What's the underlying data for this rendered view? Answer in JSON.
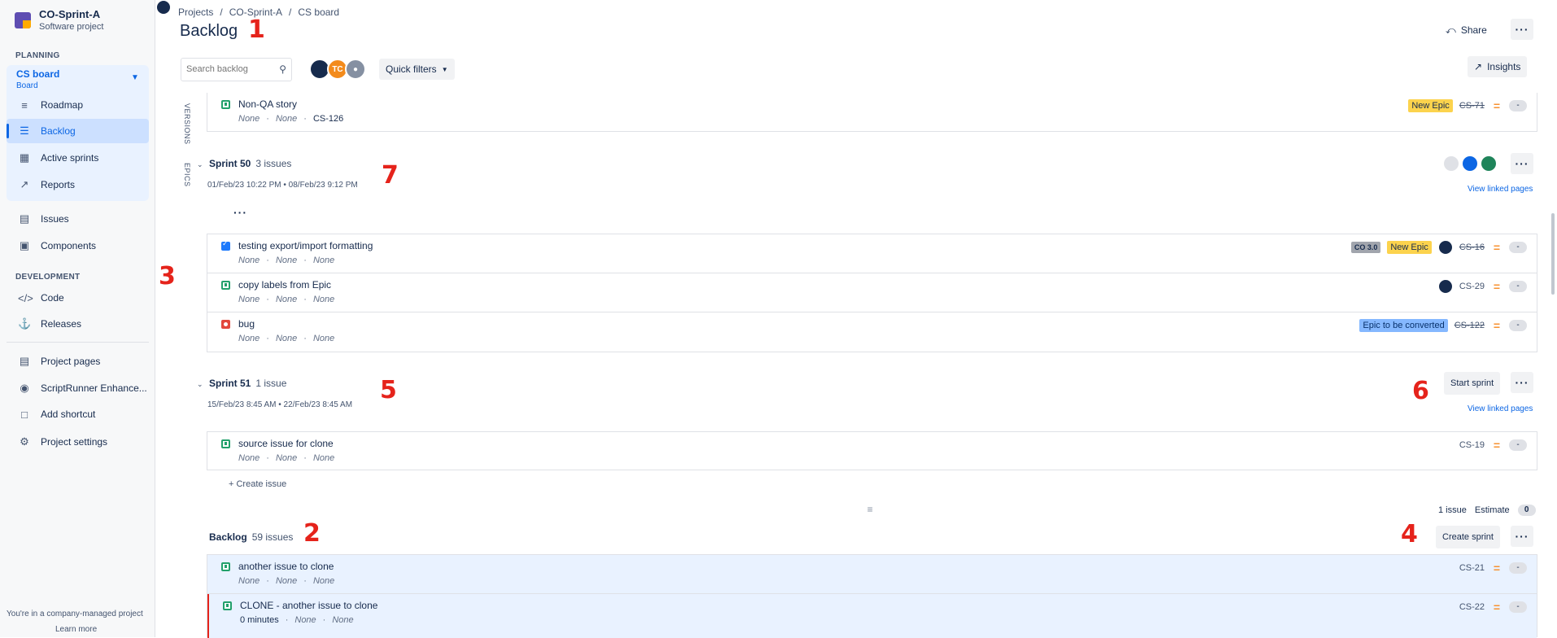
{
  "project": {
    "name": "CO-Sprint-A",
    "type": "Software project"
  },
  "sidebar": {
    "planning_label": "PLANNING",
    "board_title": "CS board",
    "board_sub": "Board",
    "roadmap": "Roadmap",
    "backlog": "Backlog",
    "active_sprints": "Active sprints",
    "reports": "Reports",
    "issues": "Issues",
    "components": "Components",
    "dev_label": "DEVELOPMENT",
    "code": "Code",
    "releases": "Releases",
    "project_pages": "Project pages",
    "scriptrunner": "ScriptRunner Enhance...",
    "add_shortcut": "Add shortcut",
    "project_settings": "Project settings",
    "footer_text": "You're in a company-managed project",
    "footer_link": "Learn more"
  },
  "breadcrumbs": [
    "Projects",
    "/",
    "CO-Sprint-A",
    "/",
    "CS board"
  ],
  "page_title": "Backlog",
  "header": {
    "share": "Share",
    "insights": "Insights",
    "quick_filters": "Quick filters",
    "search_placeholder": "Search backlog",
    "avatar_tc": "TC"
  },
  "side_tabs": {
    "versions": "VERSIONS",
    "epics": "EPICS"
  },
  "annotations": {
    "n1": "1",
    "n2": "2",
    "n3": "3",
    "n4": "4",
    "n5": "5",
    "n6": "6",
    "n7": "7"
  },
  "top_issue": {
    "title": "Non-QA story",
    "meta1": "None",
    "meta2": "None",
    "key_in_meta": "CS-126",
    "epic": "New Epic",
    "key": "CS-71",
    "est": "-"
  },
  "sprint50": {
    "name": "Sprint 50",
    "count": "3 issues",
    "dates": "01/Feb/23 10:22 PM  •  08/Feb/23 9:12 PM",
    "linked": "View linked pages",
    "issues": [
      {
        "title": "testing export/import formatting",
        "m": [
          "None",
          "None",
          "None"
        ],
        "fix": "CO 3.0",
        "epic": "New Epic",
        "key": "CS-16",
        "est": "-"
      },
      {
        "title": "copy labels from Epic",
        "m": [
          "None",
          "None",
          "None"
        ],
        "key": "CS-29",
        "est": "-"
      },
      {
        "title": "bug",
        "m": [
          "None",
          "None",
          "None"
        ],
        "epic": "Epic to be converted",
        "key": "CS-122",
        "est": "-"
      }
    ]
  },
  "sprint51": {
    "name": "Sprint 51",
    "count": "1 issue",
    "dates": "15/Feb/23 8:45 AM  •  22/Feb/23 8:45 AM",
    "start": "Start sprint",
    "linked": "View linked pages",
    "issues": [
      {
        "title": "source issue for clone",
        "m": [
          "None",
          "None",
          "None"
        ],
        "key": "CS-19",
        "est": "-"
      }
    ],
    "create_issue": "+   Create issue",
    "summary": "1 issue",
    "estimate_label": "Estimate",
    "estimate_value": "0"
  },
  "backlog": {
    "name": "Backlog",
    "count": "59 issues",
    "create_sprint": "Create sprint",
    "issues": [
      {
        "title": "another issue to clone",
        "m": [
          "None",
          "None",
          "None"
        ],
        "key": "CS-21",
        "est": "-"
      },
      {
        "title": "CLONE - another issue to clone",
        "m": [
          "0 minutes",
          "None",
          "None"
        ],
        "key": "CS-22",
        "est": "-"
      }
    ]
  },
  "colors": {
    "accent": "#0c66e4",
    "annotation": "#e5231b",
    "selected_row": "#e9f2ff"
  }
}
